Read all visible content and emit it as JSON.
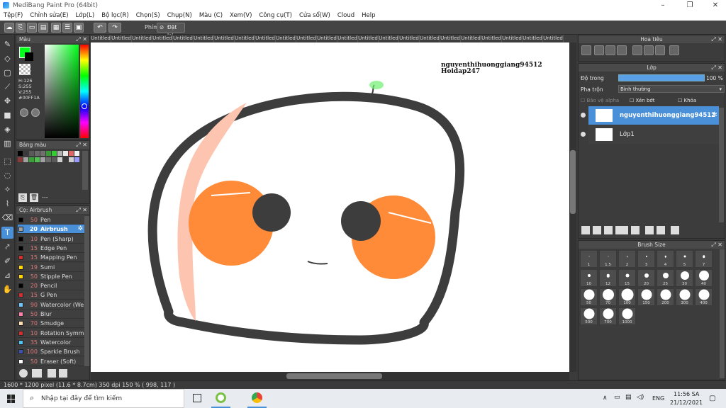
{
  "window": {
    "title": "MediBang Paint Pro (64bit)",
    "minimize": "–",
    "maximize": "❐",
    "close": "✕"
  },
  "menu": [
    "Tệp(F)",
    "Chỉnh sửa(E)",
    "Lớp(L)",
    "Bộ lọc(R)",
    "Chọn(S)",
    "Chụp(N)",
    "Màu (C)",
    "Xem(V)",
    "Công cụ(T)",
    "Cửa sổ(W)",
    "Cloud",
    "Help"
  ],
  "toolbar": {
    "key_label": "Phím",
    "reset_label": "Đặt lại"
  },
  "color_panel": {
    "title": "Màu",
    "h": "H:126",
    "s": "S:255",
    "v": "V:255",
    "hex": "#00FF1A",
    "fg": "#00ff1a",
    "bg": "#000000"
  },
  "palette_panel": {
    "title": "Bảng màu",
    "add_label": "---",
    "swatches": [
      "#000000",
      "#3a3a3a",
      "#5a5a5a",
      "#6a6a6a",
      "#707070",
      "#3a9a3a",
      "#33cc33",
      "#b0b0b0",
      "#e8e8e8",
      "#e06666",
      "#f0f0f0",
      "#8a3a3a",
      "#a0a0a0",
      "#3aa03a",
      "#50c050",
      "#a0a0a0",
      "#6a6a6a",
      "#5a5a5a",
      "#d0d0d0",
      "#3a3a3a",
      "#d0d0d0",
      "#9999ff"
    ]
  },
  "brush_panel": {
    "title": "Cọ: Airbrush",
    "items": [
      {
        "size": "50",
        "name": "Pen",
        "color": "#000000"
      },
      {
        "size": "20",
        "name": "Airbrush",
        "color": "#a0a0a0"
      },
      {
        "size": "10",
        "name": "Pen (Sharp)",
        "color": "#000000"
      },
      {
        "size": "15",
        "name": "Edge Pen",
        "color": "#000000"
      },
      {
        "size": "15",
        "name": "Mapping Pen",
        "color": "#d32f2f"
      },
      {
        "size": "19",
        "name": "Sumi",
        "color": "#ffd600"
      },
      {
        "size": "50",
        "name": "Stipple Pen",
        "color": "#ffd600"
      },
      {
        "size": "20",
        "name": "Pencil",
        "color": "#000000"
      },
      {
        "size": "15",
        "name": "G Pen",
        "color": "#d32f2f"
      },
      {
        "size": "90",
        "name": "Watercolor (We",
        "color": "#6ec6ff"
      },
      {
        "size": "50",
        "name": "Blur",
        "color": "#ff80ab"
      },
      {
        "size": "70",
        "name": "Smudge",
        "color": "#ffe0b2"
      },
      {
        "size": "10",
        "name": "Rotation Symm",
        "color": "#d32f2f"
      },
      {
        "size": "35",
        "name": "Watercolor",
        "color": "#4fc3f7"
      },
      {
        "size": "100",
        "name": "Sparkle Brush",
        "color": "#3f51b5"
      },
      {
        "size": "50",
        "name": "Eraser (Soft)",
        "color": "#ffffff"
      }
    ]
  },
  "tabs": [
    "Untitled",
    "Untitled",
    "Untitled",
    "Untitled",
    "Untitled",
    "Untitled",
    "Untitled",
    "Untitled",
    "Untitled",
    "Untitled",
    "Untitled",
    "Untitled",
    "Untitled",
    "Untitled",
    "Untitled",
    "Untitled",
    "Untitled",
    "Untitled",
    "Untitled",
    "Untitled",
    "Untitled",
    "Untitled",
    "Untitled"
  ],
  "canvas": {
    "text1": "nguyenthihuonggiang94512",
    "text2": "Hoidap247"
  },
  "navigator": {
    "title": "Hoa tiêu"
  },
  "layer_panel": {
    "title": "Lớp",
    "opacity_label": "Độ trong",
    "opacity_value": "100 %",
    "blend_label": "Pha trộn",
    "blend_value": "Bình thường",
    "protect_alpha": "Bảo vệ alpha",
    "clipping": "Xén bớt",
    "lock": "Khóa",
    "layers": [
      {
        "name": "nguyenthihuonggiang94512",
        "selected": true
      },
      {
        "name": "Lớp1",
        "selected": false
      }
    ]
  },
  "brush_size": {
    "title": "Brush Size",
    "sizes": [
      {
        "label": "1",
        "d": 1
      },
      {
        "label": "1.5",
        "d": 1
      },
      {
        "label": "2",
        "d": 1.5
      },
      {
        "label": "3",
        "d": 2
      },
      {
        "label": "4",
        "d": 2.5
      },
      {
        "label": "5",
        "d": 3
      },
      {
        "label": "7",
        "d": 3.5
      },
      {
        "label": "10",
        "d": 4
      },
      {
        "label": "12",
        "d": 4.5
      },
      {
        "label": "15",
        "d": 5
      },
      {
        "label": "20",
        "d": 6
      },
      {
        "label": "25",
        "d": 8
      },
      {
        "label": "30",
        "d": 12
      },
      {
        "label": "40",
        "d": 14
      },
      {
        "label": "50",
        "d": 15
      },
      {
        "label": "70",
        "d": 16
      },
      {
        "label": "100",
        "d": 17
      },
      {
        "label": "150",
        "d": 15
      },
      {
        "label": "200",
        "d": 15
      },
      {
        "label": "300",
        "d": 15
      },
      {
        "label": "400",
        "d": 15
      },
      {
        "label": "500",
        "d": 15
      },
      {
        "label": "700",
        "d": 15
      },
      {
        "label": "1000",
        "d": 15
      }
    ]
  },
  "status": {
    "text": "1600 * 1200 pixel   (11.6 * 8.7cm)   350 dpi   150 %   ( 998, 117 )"
  },
  "taskbar": {
    "search_placeholder": "Nhập tại đây để tìm kiếm",
    "lang": "ENG",
    "time": "11:56 SA",
    "date": "21/12/2021"
  }
}
